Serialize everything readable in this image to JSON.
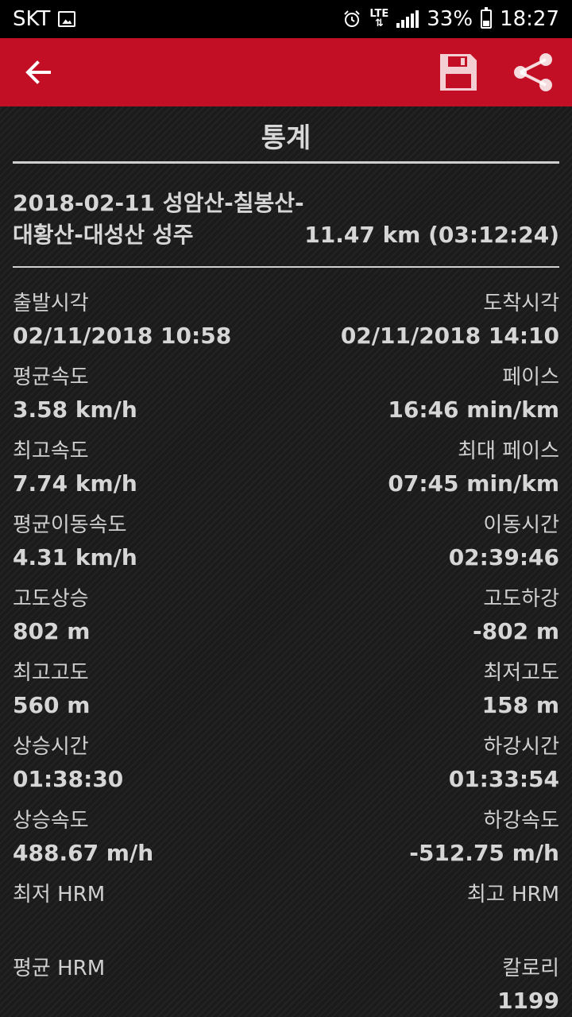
{
  "status_bar": {
    "carrier": "SKT",
    "network": "LTE",
    "battery": "33%",
    "time": "18:27"
  },
  "screen": {
    "title": "통계"
  },
  "trip": {
    "name_line1": "2018-02-11 성암산-칠봉산-",
    "name_line2": "대황산-대성산  성주",
    "distance_duration": "11.47 km (03:12:24)"
  },
  "stats": [
    {
      "left_label": "출발시각",
      "left_value": "02/11/2018 10:58",
      "right_label": "도착시각",
      "right_value": "02/11/2018 14:10"
    },
    {
      "left_label": "평균속도",
      "left_value": "3.58 km/h",
      "right_label": "페이스",
      "right_value": "16:46 min/km"
    },
    {
      "left_label": "최고속도",
      "left_value": "7.74 km/h",
      "right_label": "최대 페이스",
      "right_value": "07:45 min/km"
    },
    {
      "left_label": "평균이동속도",
      "left_value": "4.31 km/h",
      "right_label": "이동시간",
      "right_value": "02:39:46"
    },
    {
      "left_label": "고도상승",
      "left_value": "802 m",
      "right_label": "고도하강",
      "right_value": "-802 m"
    },
    {
      "left_label": "최고고도",
      "left_value": "560 m",
      "right_label": "최저고도",
      "right_value": "158 m"
    },
    {
      "left_label": "상승시간",
      "left_value": "01:38:30",
      "right_label": "하강시간",
      "right_value": "01:33:54"
    },
    {
      "left_label": "상승속도",
      "left_value": "488.67 m/h",
      "right_label": "하강속도",
      "right_value": "-512.75 m/h"
    },
    {
      "left_label": "최저 HRM",
      "left_value": "",
      "right_label": "최고 HRM",
      "right_value": ""
    },
    {
      "left_label": "평균 HRM",
      "left_value": "",
      "right_label": "칼로리",
      "right_value": "1199"
    }
  ],
  "icons": {
    "back": "arrow-back-icon",
    "save": "floppy-disk-icon",
    "share": "share-icon"
  },
  "colors": {
    "app_bar": "#c30f25",
    "background": "#1b1b1b",
    "text": "#d6d6d6"
  }
}
